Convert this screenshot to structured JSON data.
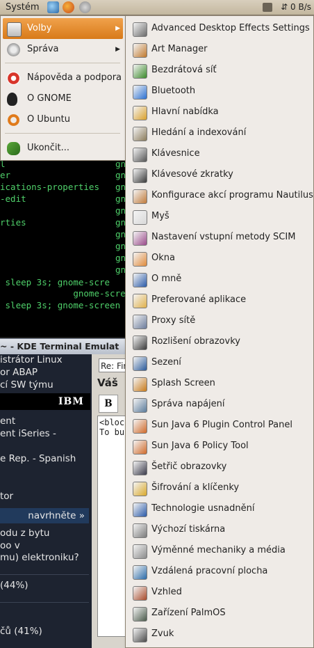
{
  "panel": {
    "system_menu": "Systém",
    "network_monitor": "0 B/s"
  },
  "main_menu": {
    "items": [
      {
        "label": "Volby",
        "icon": "preferences-icon",
        "has_submenu": true,
        "active": true
      },
      {
        "label": "Správa",
        "icon": "administration-icon",
        "has_submenu": true
      },
      {
        "label": "Nápověda a podpora",
        "icon": "help-icon"
      },
      {
        "label": "O GNOME",
        "icon": "gnome-foot-icon"
      },
      {
        "label": "O Ubuntu",
        "icon": "ubuntu-logo-icon"
      },
      {
        "label": "Ukončit...",
        "icon": "logout-icon"
      }
    ]
  },
  "submenu": {
    "items": [
      {
        "label": "Advanced Desktop Effects Settings",
        "icon": "desktop-effects-icon",
        "color": "#6a6a6a"
      },
      {
        "label": "Art Manager",
        "icon": "art-manager-icon",
        "color": "#c0782c"
      },
      {
        "label": "Bezdrátová síť",
        "icon": "wireless-icon",
        "color": "#3b8a2a"
      },
      {
        "label": "Bluetooth",
        "icon": "bluetooth-icon",
        "color": "#2a6fd1"
      },
      {
        "label": "Hlavní nabídka",
        "icon": "main-menu-icon",
        "color": "#d9a02a"
      },
      {
        "label": "Hledání a indexování",
        "icon": "search-index-icon",
        "color": "#8a7a5a"
      },
      {
        "label": "Klávesnice",
        "icon": "keyboard-icon",
        "color": "#555555"
      },
      {
        "label": "Klávesové zkratky",
        "icon": "keyboard-shortcuts-icon",
        "color": "#3a3a3a"
      },
      {
        "label": "Konfigurace akcí programu Nautilus",
        "icon": "nautilus-actions-icon",
        "color": "#c07a3a"
      },
      {
        "label": "Myš",
        "icon": "mouse-icon",
        "color": "#d8d8d8"
      },
      {
        "label": "Nastavení vstupní metody SCIM",
        "icon": "scim-icon",
        "color": "#9a4a8a"
      },
      {
        "label": "Okna",
        "icon": "windows-icon",
        "color": "#e08a3a"
      },
      {
        "label": "O mně",
        "icon": "about-me-icon",
        "color": "#2a5aa8"
      },
      {
        "label": "Preferované aplikace",
        "icon": "preferred-apps-icon",
        "color": "#e0b04a"
      },
      {
        "label": "Proxy sítě",
        "icon": "proxy-icon",
        "color": "#6a7a9a"
      },
      {
        "label": "Rozlišení obrazovky",
        "icon": "screen-resolution-icon",
        "color": "#3a3a3a"
      },
      {
        "label": "Sezení",
        "icon": "sessions-icon",
        "color": "#2a5a9a"
      },
      {
        "label": "Splash Screen",
        "icon": "splash-screen-icon",
        "color": "#c87a1a"
      },
      {
        "label": "Správa napájení",
        "icon": "power-management-icon",
        "color": "#5a7a9a"
      },
      {
        "label": "Sun Java 6 Plugin Control Panel",
        "icon": "java-plugin-icon",
        "color": "#d06a2a"
      },
      {
        "label": "Sun Java 6 Policy Tool",
        "icon": "java-policy-icon",
        "color": "#d06a2a"
      },
      {
        "label": "Šetřič obrazovky",
        "icon": "screensaver-icon",
        "color": "#3a3a4a"
      },
      {
        "label": "Šifrování a klíčenky",
        "icon": "encryption-keys-icon",
        "color": "#d9a82a"
      },
      {
        "label": "Technologie usnadnění",
        "icon": "accessibility-icon",
        "color": "#2a5aa8"
      },
      {
        "label": "Výchozí tiskárna",
        "icon": "printer-icon",
        "color": "#7a7a7a"
      },
      {
        "label": "Výměnné mechaniky a média",
        "icon": "removable-drives-icon",
        "color": "#8a8a8a"
      },
      {
        "label": "Vzdálená pracovní plocha",
        "icon": "remote-desktop-icon",
        "color": "#2a6aa8"
      },
      {
        "label": "Vzhled",
        "icon": "appearance-icon",
        "color": "#a84a2a"
      },
      {
        "label": "Zařízení PalmOS",
        "icon": "palmos-icon",
        "color": "#4a5a4a"
      },
      {
        "label": "Zvuk",
        "icon": "sound-icon",
        "color": "#4a4a4a"
      }
    ]
  },
  "terminal": {
    "lines": [
      "l",
      "er",
      "ications-properties",
      "-edit",
      "",
      "rties",
      "",
      "",
      "",
      "",
      " sleep 3s; gnome-scre",
      "              gnome-scre",
      " sleep 3s; gnome-screen"
    ],
    "column_text": "gn",
    "title": "~ - KDE Terminal Emulat"
  },
  "webpage": {
    "left_lines": [
      "istrátor Linux",
      "or ABAP",
      "cí SW týmu"
    ],
    "ibm": "IBM",
    "mid_lines": [
      "ent",
      "ent iSeries -",
      "",
      "e Rep. - Spanish",
      "",
      "tor"
    ],
    "suggest": "navrhněte »",
    "poll_lines": [
      "odu z bytu",
      "oo v",
      "mu) elektroniku?"
    ],
    "percent_44": "(44%)",
    "percent_41": "čů (41%)",
    "editor_subject": "Re: Fir",
    "editor_heading": "Váš",
    "editor_bold": "B",
    "editor_text": "<bloc\nTo bu"
  }
}
